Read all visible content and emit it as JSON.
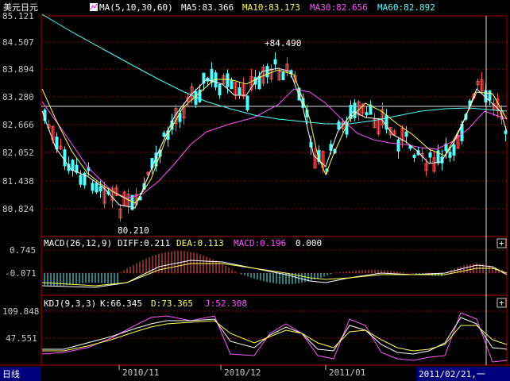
{
  "colors": {
    "ma5": "#ffffff",
    "ma10": "#ffff55",
    "ma30": "#ff55ff",
    "ma60": "#55ffff",
    "up": "#ff5555",
    "down": "#55ffff",
    "frame": "#b00000",
    "grid": "#a00000",
    "selected": "#00007a"
  },
  "header": {
    "title": "美元日元",
    "ma_label": "MA(5,10,30,60)",
    "ma_icon": "ma-indicator-icon",
    "ma5": "MA5:83.366",
    "ma10": "MA10:83.173",
    "ma30": "MA30:82.656",
    "ma60": "MA60:82.892"
  },
  "macd_header": {
    "name": "MACD(26,12,9)",
    "diff": "DIFF:0.211",
    "dea": "DEA:0.113",
    "macd": "MACD:0.196",
    "extra": "0.000"
  },
  "kdj_header": {
    "name": "KDJ(9,3,3)",
    "k": "K:66.345",
    "d": "D:73.365",
    "j": "J:52.308"
  },
  "footer": {
    "period": "日线",
    "selected_date": "2011/02/21,一",
    "expand_symbol": "+"
  },
  "chart_data": [
    {
      "type": "candlestick",
      "name": "美元日元",
      "y_ticks": [
        "85.121",
        "84.507",
        "83.894",
        "83.280",
        "82.666",
        "82.052",
        "81.438",
        "80.824"
      ],
      "ylim": [
        80.21,
        85.121
      ],
      "high_marker": "+84.490",
      "low_marker": "80.210",
      "x_labels": [
        "2010/11",
        "2010/12",
        "2011/01"
      ],
      "legend": [
        "MA5",
        "MA10",
        "MA30",
        "MA60"
      ]
    },
    {
      "type": "bar",
      "name": "MACD",
      "y_ticks": [
        "0.745",
        "-0.071"
      ],
      "series": [
        "DIFF",
        "DEA",
        "MACD"
      ]
    },
    {
      "type": "line",
      "name": "KDJ",
      "y_ticks": [
        "109.848",
        "47.551"
      ],
      "series": [
        "K",
        "D",
        "J"
      ]
    }
  ]
}
